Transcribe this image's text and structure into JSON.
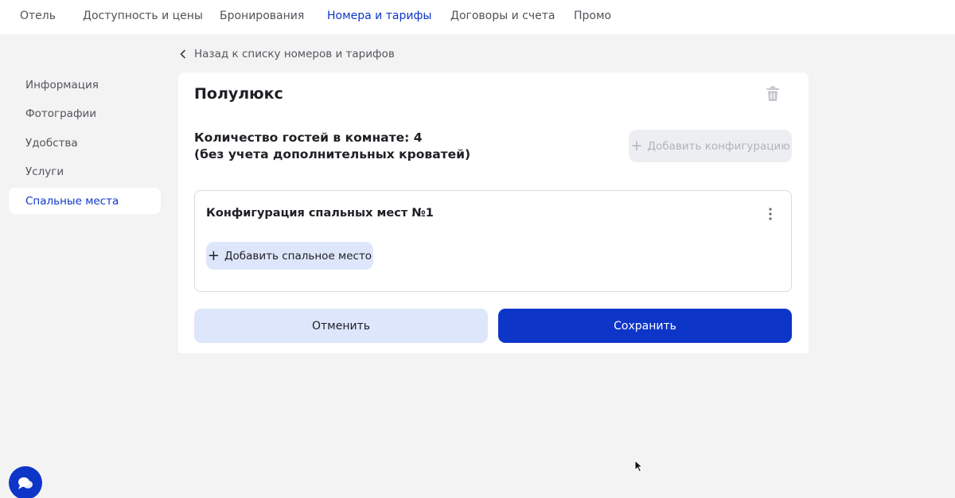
{
  "topnav": {
    "tabs": [
      {
        "label": "Отель",
        "active": false
      },
      {
        "label": "Доступность и цены",
        "active": false
      },
      {
        "label": "Бронирования",
        "active": false
      },
      {
        "label": "Номера и тарифы",
        "active": true
      },
      {
        "label": "Договоры и счета",
        "active": false
      },
      {
        "label": "Промо",
        "active": false
      }
    ]
  },
  "sidebar": {
    "items": [
      {
        "label": "Информация",
        "active": false
      },
      {
        "label": "Фотографии",
        "active": false
      },
      {
        "label": "Удобства",
        "active": false
      },
      {
        "label": "Услуги",
        "active": false
      },
      {
        "label": "Спальные места",
        "active": true
      }
    ]
  },
  "back_link": {
    "label": "Назад к списку номеров и тарифов",
    "icon": "chevron-left-icon"
  },
  "room": {
    "title": "Полулюкс",
    "delete_icon": "trash-icon",
    "guests_line1": "Количество гостей в комнате: 4",
    "guests_line2": "(без учета дополнительных кроватей)",
    "add_config_label": "Добавить конфигурацию",
    "add_config_disabled": true
  },
  "configuration": {
    "title": "Конфигурация спальных мест №1",
    "menu_icon": "kebab-icon",
    "add_bed_label": "Добавить спальное место"
  },
  "actions": {
    "cancel_label": "Отменить",
    "save_label": "Сохранить"
  },
  "colors": {
    "accent": "#0d36c9",
    "accent_light": "#dde6fb",
    "background": "#f3f3f4",
    "surface": "#ffffff"
  }
}
